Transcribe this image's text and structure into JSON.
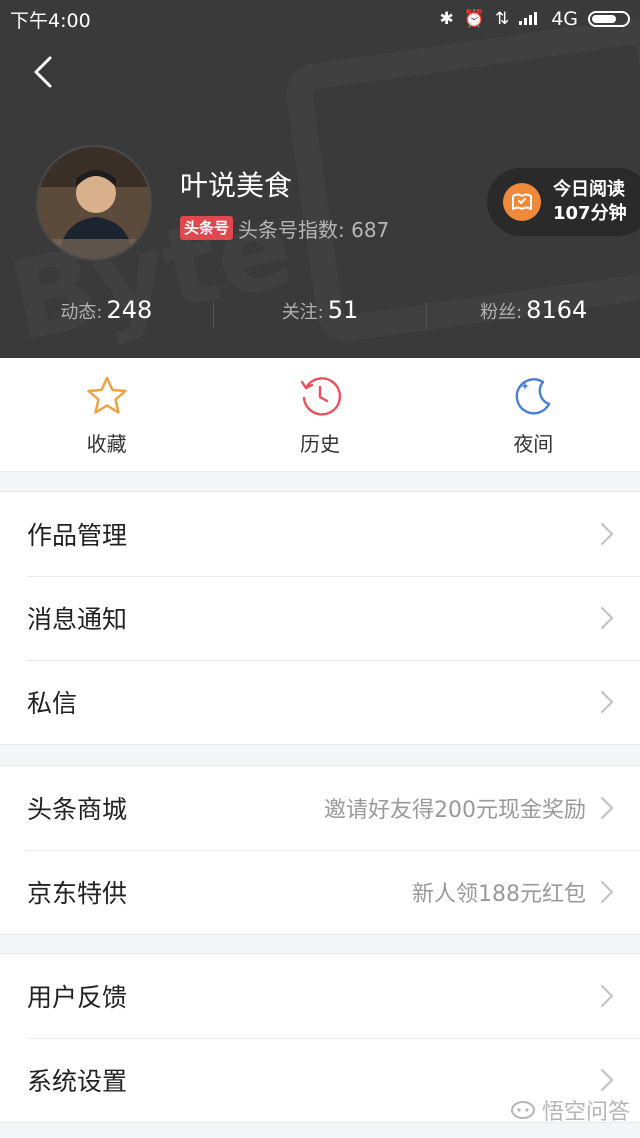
{
  "status_bar": {
    "time": "下午4:00",
    "network": "4G"
  },
  "profile": {
    "name": "叶说美食",
    "badge": "头条号",
    "score_label": "头条号指数",
    "score_value": "687"
  },
  "reading": {
    "line1": "今日阅读",
    "line2": "107分钟"
  },
  "stats": [
    {
      "label": "动态:",
      "value": "248"
    },
    {
      "label": "关注:",
      "value": "51"
    },
    {
      "label": "粉丝:",
      "value": "8164"
    }
  ],
  "quick_actions": [
    {
      "label": "收藏",
      "icon": "star-icon",
      "color": "#f0a03c"
    },
    {
      "label": "历史",
      "icon": "history-icon",
      "color": "#e8505b"
    },
    {
      "label": "夜间",
      "icon": "moon-icon",
      "color": "#4a7fd6"
    }
  ],
  "menu": {
    "group1": [
      {
        "label": "作品管理",
        "sub": ""
      },
      {
        "label": "消息通知",
        "sub": ""
      },
      {
        "label": "私信",
        "sub": ""
      }
    ],
    "group2": [
      {
        "label": "头条商城",
        "sub": "邀请好友得200元现金奖励"
      },
      {
        "label": "京东特供",
        "sub": "新人领188元红包"
      }
    ],
    "group3": [
      {
        "label": "用户反馈",
        "sub": ""
      },
      {
        "label": "系统设置",
        "sub": ""
      }
    ]
  },
  "watermark": "悟空问答"
}
